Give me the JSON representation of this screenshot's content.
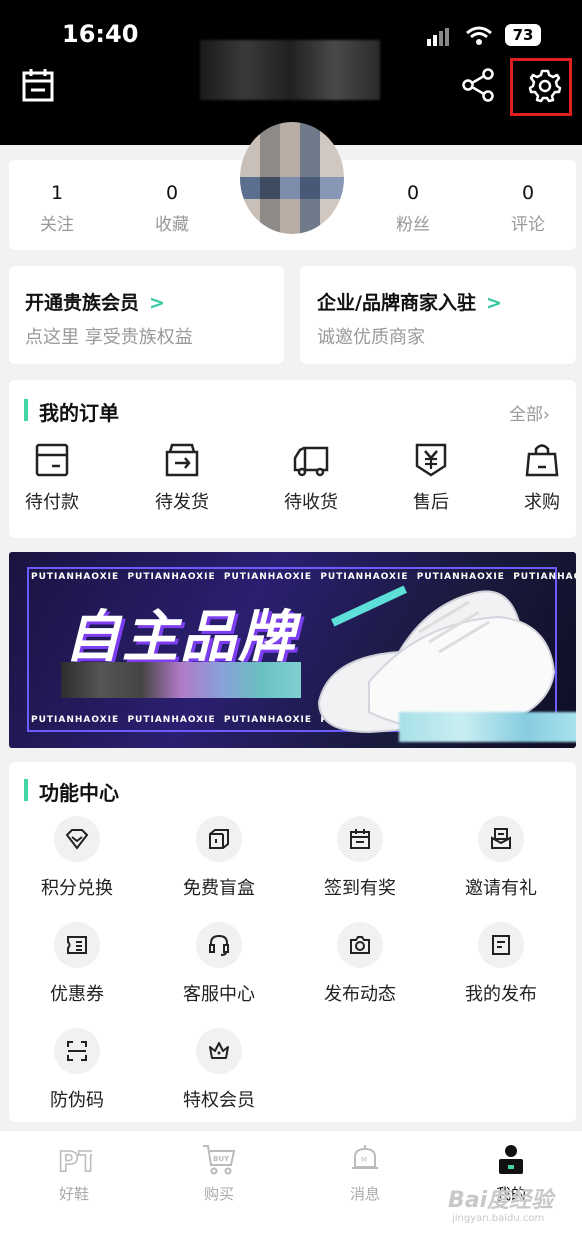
{
  "status": {
    "time": "16:40",
    "battery": "73"
  },
  "stats": [
    {
      "value": "1",
      "label": "关注"
    },
    {
      "value": "0",
      "label": "收藏"
    },
    {
      "value": "0",
      "label": "粉丝"
    },
    {
      "value": "0",
      "label": "评论"
    }
  ],
  "promos": [
    {
      "title": "开通贵族会员",
      "subtitle": "点这里 享受贵族权益"
    },
    {
      "title": "企业/品牌商家入驻",
      "subtitle": "诚邀优质商家"
    }
  ],
  "orders": {
    "title": "我的订单",
    "all_label": "全部",
    "items": [
      {
        "label": "待付款",
        "icon": "wallet-icon"
      },
      {
        "label": "待发货",
        "icon": "package-out-icon"
      },
      {
        "label": "待收货",
        "icon": "truck-icon"
      },
      {
        "label": "售后",
        "icon": "yen-shield-icon"
      },
      {
        "label": "求购",
        "icon": "shopping-bag-icon"
      }
    ]
  },
  "banner": {
    "title": "自主品牌",
    "pattern_text": "PUTIANHAOXIE"
  },
  "functions": {
    "title": "功能中心",
    "items": [
      {
        "label": "积分兑换",
        "icon": "diamond-icon"
      },
      {
        "label": "免费盲盒",
        "icon": "box-icon"
      },
      {
        "label": "签到有奖",
        "icon": "calendar-icon"
      },
      {
        "label": "邀请有礼",
        "icon": "invite-icon"
      },
      {
        "label": "优惠券",
        "icon": "coupon-icon"
      },
      {
        "label": "客服中心",
        "icon": "headset-icon"
      },
      {
        "label": "发布动态",
        "icon": "camera-icon"
      },
      {
        "label": "我的发布",
        "icon": "document-icon"
      },
      {
        "label": "防伪码",
        "icon": "scan-icon"
      },
      {
        "label": "特权会员",
        "icon": "crown-icon"
      }
    ]
  },
  "nav": [
    {
      "label": "好鞋",
      "icon": "pt-logo-icon"
    },
    {
      "label": "购买",
      "icon": "buy-cart-icon"
    },
    {
      "label": "消息",
      "icon": "bell-icon"
    },
    {
      "label": "我的",
      "icon": "profile-icon",
      "active": true
    }
  ],
  "watermark": {
    "main": "Bai度经验",
    "sub": "jingyan.baidu.com"
  },
  "colors": {
    "accent": "#45d6a8",
    "highlight": "#e02020",
    "header": "#000000"
  }
}
